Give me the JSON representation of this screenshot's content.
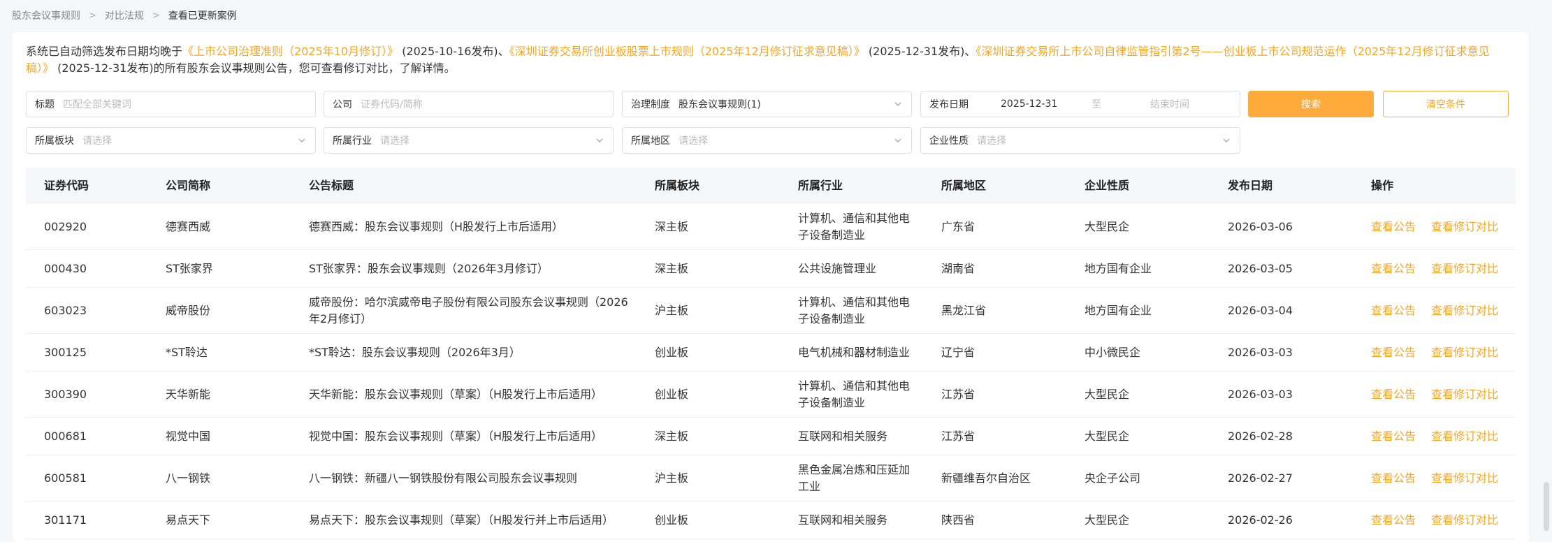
{
  "breadcrumb": {
    "items": [
      "股东会议事规则",
      "对比法规",
      "查看已更新案例"
    ]
  },
  "notice": {
    "prefix": "系统已自动筛选发布日期均晚于",
    "law1": "《上市公司治理准则（2025年10月修订）》",
    "law1_date": "(2025-10-16发布)",
    "sep": "、",
    "law2": "《深圳证券交易所创业板股票上市规则（2025年12月修订征求意见稿）》",
    "law2_date": "(2025-12-31发布)",
    "law3": "《深圳证券交易所上市公司自律监管指引第2号——创业板上市公司规范运作（2025年12月修订征求意见稿）》",
    "law3_date": "(2025-12-31发布)",
    "suffix": "的所有股东会议事规则公告，您可查看修订对比，了解详情。"
  },
  "filters": {
    "title": {
      "label": "标题",
      "placeholder": "匹配全部关键词"
    },
    "company": {
      "label": "公司",
      "placeholder": "证券代码/简称"
    },
    "system": {
      "label": "治理制度",
      "value": "股东会议事规则(1)"
    },
    "date": {
      "label": "发布日期",
      "start": "2025-12-31",
      "to": "至",
      "end_placeholder": "结束时间"
    },
    "board": {
      "label": "所属板块",
      "placeholder": "请选择"
    },
    "industry": {
      "label": "所属行业",
      "placeholder": "请选择"
    },
    "region": {
      "label": "所属地区",
      "placeholder": "请选择"
    },
    "nature": {
      "label": "企业性质",
      "placeholder": "请选择"
    }
  },
  "buttons": {
    "search": "搜索",
    "clear": "清空条件"
  },
  "table": {
    "headers": [
      "证券代码",
      "公司简称",
      "公告标题",
      "所属板块",
      "所属行业",
      "所属地区",
      "企业性质",
      "发布日期",
      "操作"
    ],
    "action_view": "查看公告",
    "action_compare": "查看修订对比",
    "rows": [
      {
        "code": "002920",
        "name": "德赛西威",
        "title": "德赛西威：股东会议事规则（H股发行上市后适用）",
        "board": "深主板",
        "industry": "计算机、通信和其他电子设备制造业",
        "region": "广东省",
        "nature": "大型民企",
        "date": "2026-03-06"
      },
      {
        "code": "000430",
        "name": "ST张家界",
        "title": "ST张家界：股东会议事规则（2026年3月修订）",
        "board": "深主板",
        "industry": "公共设施管理业",
        "region": "湖南省",
        "nature": "地方国有企业",
        "date": "2026-03-05"
      },
      {
        "code": "603023",
        "name": "威帝股份",
        "title": "威帝股份：哈尔滨威帝电子股份有限公司股东会议事规则（2026年2月修订）",
        "board": "沪主板",
        "industry": "计算机、通信和其他电子设备制造业",
        "region": "黑龙江省",
        "nature": "地方国有企业",
        "date": "2026-03-04"
      },
      {
        "code": "300125",
        "name": "*ST聆达",
        "title": "*ST聆达：股东会议事规则（2026年3月）",
        "board": "创业板",
        "industry": "电气机械和器材制造业",
        "region": "辽宁省",
        "nature": "中小微民企",
        "date": "2026-03-03"
      },
      {
        "code": "300390",
        "name": "天华新能",
        "title": "天华新能：股东会议事规则（草案）（H股发行上市后适用）",
        "board": "创业板",
        "industry": "计算机、通信和其他电子设备制造业",
        "region": "江苏省",
        "nature": "大型民企",
        "date": "2026-03-03"
      },
      {
        "code": "000681",
        "name": "视觉中国",
        "title": "视觉中国：股东会议事规则（草案）（H股发行上市后适用）",
        "board": "深主板",
        "industry": "互联网和相关服务",
        "region": "江苏省",
        "nature": "大型民企",
        "date": "2026-02-28"
      },
      {
        "code": "600581",
        "name": "八一钢铁",
        "title": "八一钢铁：新疆八一钢铁股份有限公司股东会议事规则",
        "board": "沪主板",
        "industry": "黑色金属冶炼和压延加工业",
        "region": "新疆维吾尔自治区",
        "nature": "央企子公司",
        "date": "2026-02-27"
      },
      {
        "code": "301171",
        "name": "易点天下",
        "title": "易点天下：股东会议事规则（草案）（H股发行并上市后适用）",
        "board": "创业板",
        "industry": "互联网和相关服务",
        "region": "陕西省",
        "nature": "大型民企",
        "date": "2026-02-26"
      }
    ]
  }
}
